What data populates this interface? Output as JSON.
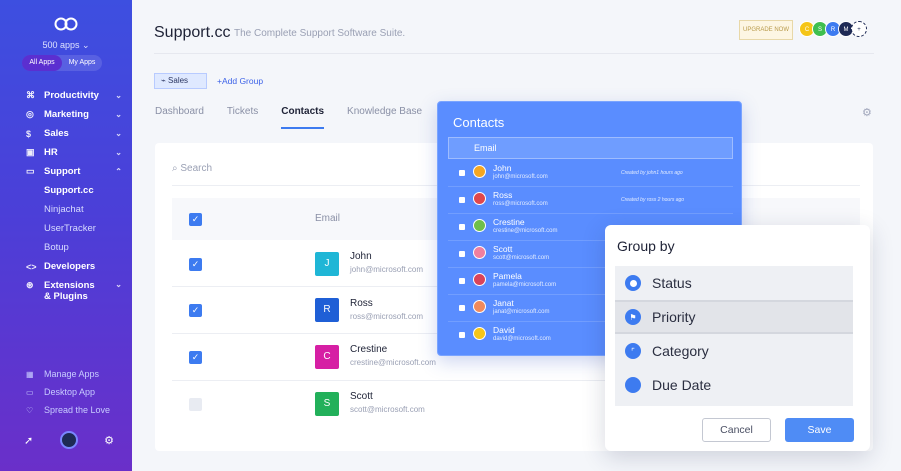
{
  "sidebar": {
    "apps_count": "500 apps",
    "toggle": [
      "All Apps",
      "My Apps"
    ],
    "nav": [
      {
        "label": "Productivity",
        "icon": "command-icon"
      },
      {
        "label": "Marketing",
        "icon": "globe-icon"
      },
      {
        "label": "Sales",
        "icon": "dollar-icon"
      },
      {
        "label": "HR",
        "icon": "briefcase-icon"
      },
      {
        "label": "Support",
        "icon": "chat-icon"
      }
    ],
    "support_sub": [
      "Support.cc",
      "Ninjachat",
      "UserTracker",
      "Botup"
    ],
    "more_nav": [
      {
        "label": "Developers",
        "icon": "code-icon"
      },
      {
        "label": "Extensions & Plugins",
        "icon": "plugin-icon"
      }
    ],
    "bottom_links": [
      "Manage Apps",
      "Desktop App",
      "Spread the Love"
    ]
  },
  "header": {
    "title": "Support.cc",
    "subtitle": "The Complete Support Software Suite.",
    "upgrade": "UPGRADE NOW",
    "team": [
      "C",
      "S",
      "R",
      "M"
    ]
  },
  "toolbar": {
    "group_label": "Sales",
    "add_group": "+Add Group"
  },
  "tabs": [
    "Dashboard",
    "Tickets",
    "Contacts",
    "Knowledge Base"
  ],
  "table": {
    "search_placeholder": "Search",
    "email_header": "Email",
    "rows": [
      {
        "initial": "J",
        "name": "John",
        "email": "john@microsoft.com",
        "color": "#1fb6d6"
      },
      {
        "initial": "R",
        "name": "Ross",
        "email": "ross@microsoft.com",
        "color": "#1f5fd6"
      },
      {
        "initial": "C",
        "name": "Crestine",
        "email": "crestine@microsoft.com",
        "color": "#d61fa4"
      },
      {
        "initial": "S",
        "name": "Scott",
        "email": "scott@microsoft.com",
        "color": "#22b05a"
      }
    ]
  },
  "contacts_popup": {
    "title": "Contacts",
    "header": "Email",
    "rows": [
      {
        "name": "John",
        "email": "john@microsoft.com",
        "meta": "Created by john1 hours ago"
      },
      {
        "name": "Ross",
        "email": "ross@microsoft.com",
        "meta": "Created by ross 2 hours ago"
      },
      {
        "name": "Crestine",
        "email": "crestine@microsoft.com",
        "meta": ""
      },
      {
        "name": "Scott",
        "email": "scott@microsoft.com",
        "meta": ""
      },
      {
        "name": "Pamela",
        "email": "pamela@microsoft.com",
        "meta": ""
      },
      {
        "name": "Janat",
        "email": "janat@microsoft.com",
        "meta": ""
      },
      {
        "name": "David",
        "email": "david@microsoft.com",
        "meta": ""
      }
    ]
  },
  "group_by": {
    "title": "Group by",
    "options": [
      "Status",
      "Priority",
      "Category",
      "Due Date"
    ],
    "selected": "Priority",
    "cancel": "Cancel",
    "save": "Save"
  }
}
